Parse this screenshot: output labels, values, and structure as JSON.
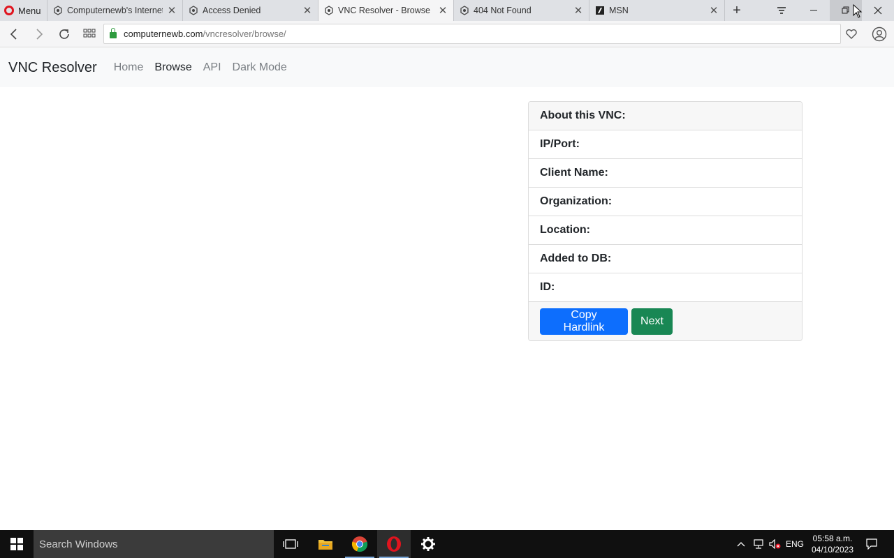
{
  "browser": {
    "menu_label": "Menu",
    "tabs": [
      {
        "title": "Computernewb's Internet",
        "active": false
      },
      {
        "title": "Access Denied",
        "active": false
      },
      {
        "title": "VNC Resolver - Browse",
        "active": true
      },
      {
        "title": "404 Not Found",
        "active": false
      },
      {
        "title": "MSN",
        "active": false
      }
    ],
    "url_domain": "computernewb.com",
    "url_path": "/vncresolver/browse/"
  },
  "page": {
    "brand": "VNC Resolver",
    "nav": [
      {
        "label": "Home",
        "active": false
      },
      {
        "label": "Browse",
        "active": true
      },
      {
        "label": "API",
        "active": false
      },
      {
        "label": "Dark Mode",
        "active": false
      }
    ],
    "card": {
      "header": "About this VNC:",
      "fields": [
        "IP/Port:",
        "Client Name:",
        "Organization:",
        "Location:",
        "Added to DB:",
        "ID:"
      ],
      "copy_button": "Copy Hardlink",
      "next_button": "Next"
    },
    "colors": {
      "primary": "#0d6efd",
      "success": "#198754"
    }
  },
  "taskbar": {
    "search_placeholder": "Search Windows",
    "language": "ENG",
    "time": "05:58 a.m.",
    "date": "04/10/2023"
  }
}
